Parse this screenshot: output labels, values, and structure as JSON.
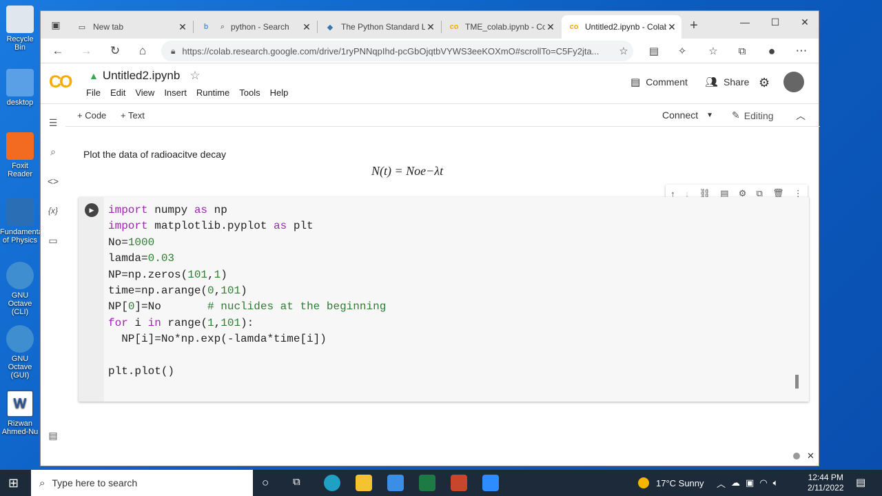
{
  "desktop": {
    "icons": [
      "Recycle Bin",
      "desktop",
      "Foxit Reader",
      "Fundamentals of Physics",
      "GNU Octave (CLI)",
      "GNU Octave (GUI)",
      "Rizwan Ahmed-Nu"
    ]
  },
  "browser": {
    "tabs": [
      {
        "label": "New tab"
      },
      {
        "label": "python - Search"
      },
      {
        "label": "The Python Standard Li"
      },
      {
        "label": "TME_colab.ipynb - Colab"
      },
      {
        "label": "Untitled2.ipynb - Colab"
      }
    ],
    "url": "https://colab.research.google.com/drive/1ryPNNqpIhd-pcGbOjqtbVYWS3eeKOXmO#scrollTo=C5Fy2jta..."
  },
  "colab": {
    "logo": "CO",
    "title": "Untitled2.ipynb",
    "menu": [
      "File",
      "Edit",
      "View",
      "Insert",
      "Runtime",
      "Tools",
      "Help"
    ],
    "comment": "Comment",
    "share": "Share",
    "add_code": "+ Code",
    "add_text": "+ Text",
    "connect": "Connect",
    "editing": "Editing",
    "text_cell": "Plot the data of radioacitve decay",
    "formula": "N(t) = Noe−λt"
  },
  "code_lines": [
    "import numpy as np",
    "import matplotlib.pyplot as plt",
    "No=1000",
    "lamda=0.03",
    "NP=np.zeros(101,1)",
    "time=np.arange(0,101)",
    "NP[0]=No       # nuclides at the beginning",
    "for i in range(1,101):",
    "  NP[i]=No*np.exp(-lamda*time[i])",
    "",
    "plt.plot()"
  ],
  "taskbar": {
    "search_placeholder": "Type here to search",
    "weather": "17°C  Sunny",
    "time": "12:44 PM",
    "date": "2/11/2022"
  }
}
